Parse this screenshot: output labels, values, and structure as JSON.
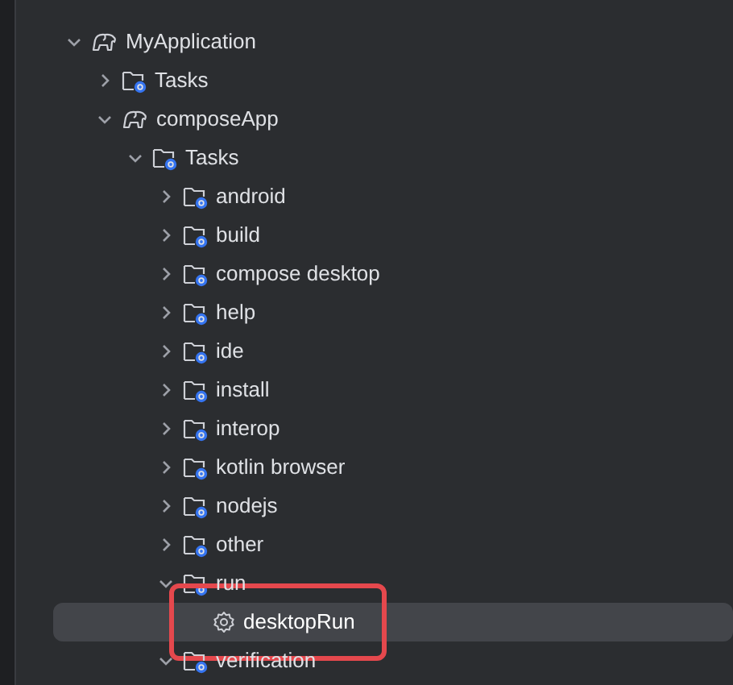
{
  "tree": [
    {
      "kind": "project",
      "label": "MyApplication",
      "expanded": true,
      "selected": false,
      "children": [
        {
          "kind": "folder",
          "label": "Tasks",
          "expanded": false,
          "selected": false
        },
        {
          "kind": "project",
          "label": "composeApp",
          "expanded": true,
          "selected": false,
          "children": [
            {
              "kind": "folder",
              "label": "Tasks",
              "expanded": true,
              "selected": false,
              "children": [
                {
                  "kind": "folder",
                  "label": "android",
                  "expanded": false,
                  "selected": false
                },
                {
                  "kind": "folder",
                  "label": "build",
                  "expanded": false,
                  "selected": false
                },
                {
                  "kind": "folder",
                  "label": "compose desktop",
                  "expanded": false,
                  "selected": false
                },
                {
                  "kind": "folder",
                  "label": "help",
                  "expanded": false,
                  "selected": false
                },
                {
                  "kind": "folder",
                  "label": "ide",
                  "expanded": false,
                  "selected": false
                },
                {
                  "kind": "folder",
                  "label": "install",
                  "expanded": false,
                  "selected": false
                },
                {
                  "kind": "folder",
                  "label": "interop",
                  "expanded": false,
                  "selected": false
                },
                {
                  "kind": "folder",
                  "label": "kotlin browser",
                  "expanded": false,
                  "selected": false
                },
                {
                  "kind": "folder",
                  "label": "nodejs",
                  "expanded": false,
                  "selected": false
                },
                {
                  "kind": "folder",
                  "label": "other",
                  "expanded": false,
                  "selected": false
                },
                {
                  "kind": "folder",
                  "label": "run",
                  "expanded": true,
                  "selected": false,
                  "children": [
                    {
                      "kind": "task",
                      "label": "desktopRun",
                      "selected": true,
                      "highlighted": true
                    }
                  ]
                },
                {
                  "kind": "folder",
                  "label": "verification",
                  "expanded": true,
                  "selected": false
                }
              ]
            }
          ]
        }
      ]
    }
  ]
}
